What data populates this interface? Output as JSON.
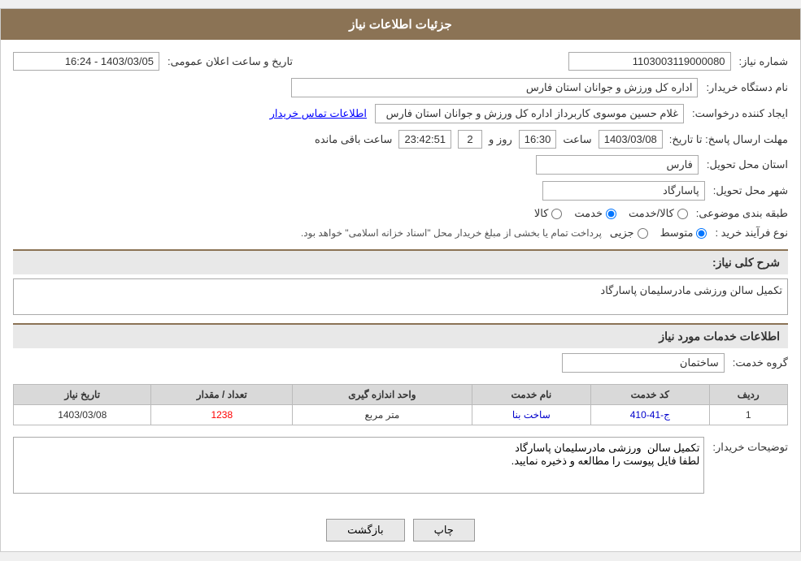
{
  "header": {
    "title": "جزئیات اطلاعات نیاز"
  },
  "fields": {
    "need_number_label": "شماره نیاز:",
    "need_number_value": "1103003119000080",
    "announcement_date_label": "تاریخ و ساعت اعلان عمومی:",
    "announcement_date_value": "1403/03/05 - 16:24",
    "buyer_org_label": "نام دستگاه خریدار:",
    "buyer_org_value": "اداره کل ورزش و جوانان استان فارس",
    "requester_label": "ایجاد کننده درخواست:",
    "requester_value": "غلام حسین موسوی کاربرداز اداره کل ورزش و جوانان استان فارس",
    "contact_link": "اطلاعات تماس خریدار",
    "reply_deadline_label": "مهلت ارسال پاسخ: تا تاریخ:",
    "reply_date_value": "1403/03/08",
    "reply_time_label": "ساعت",
    "reply_time_value": "16:30",
    "reply_day_label": "روز و",
    "reply_day_value": "2",
    "reply_countdown_label": "ساعت باقی مانده",
    "reply_countdown_value": "23:42:51",
    "province_label": "استان محل تحویل:",
    "province_value": "فارس",
    "city_label": "شهر محل تحویل:",
    "city_value": "پاسارگاد",
    "category_label": "طبقه بندی موضوعی:",
    "category_options": [
      {
        "value": "کالا",
        "label": "کالا"
      },
      {
        "value": "خدمت",
        "label": "خدمت"
      },
      {
        "value": "کالا/خدمت",
        "label": "کالا/خدمت"
      }
    ],
    "category_selected": "خدمت",
    "purchase_type_label": "نوع فرآیند خرید :",
    "purchase_type_options": [
      {
        "value": "جزیی",
        "label": "جزیی"
      },
      {
        "value": "متوسط",
        "label": "متوسط"
      }
    ],
    "purchase_type_selected": "متوسط",
    "purchase_type_note": "پرداخت تمام یا بخشی از مبلغ خریدار محل \"اسناد خزانه اسلامی\" خواهد بود.",
    "need_description_label": "شرح کلی نیاز:",
    "need_description_value": "تکمیل سالن  ورزشی مادرسلیمان پاسارگاد"
  },
  "services_section": {
    "title": "اطلاعات خدمات مورد نیاز",
    "service_group_label": "گروه خدمت:",
    "service_group_value": "ساختمان",
    "table": {
      "columns": [
        {
          "key": "row",
          "label": "ردیف"
        },
        {
          "key": "code",
          "label": "کد خدمت"
        },
        {
          "key": "name",
          "label": "نام خدمت"
        },
        {
          "key": "unit",
          "label": "واحد اندازه گیری"
        },
        {
          "key": "quantity",
          "label": "تعداد / مقدار"
        },
        {
          "key": "date",
          "label": "تاریخ نیاز"
        }
      ],
      "rows": [
        {
          "row": "1",
          "code": "ج-41-410",
          "name": "ساخت بنا",
          "unit": "متر مربع",
          "quantity": "1238",
          "date": "1403/03/08"
        }
      ]
    }
  },
  "buyer_description_label": "توضیحات خریدار:",
  "buyer_description_value": "تکمیل سالن  ورزشی مادرسلیمان پاسارگاد\nلطفا فایل پیوست را مطالعه و ذخیره نمایید.",
  "buttons": {
    "back_label": "بازگشت",
    "print_label": "چاپ"
  }
}
